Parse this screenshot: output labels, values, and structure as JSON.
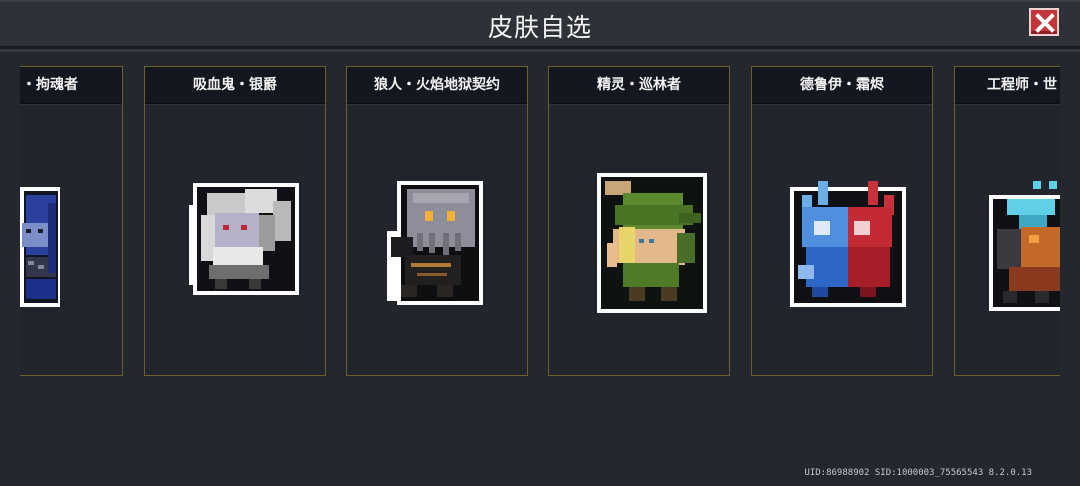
{
  "header": {
    "title": "皮肤自选"
  },
  "close_icon": "close-icon",
  "skins": [
    {
      "name": "・拘魂者"
    },
    {
      "name": "吸血鬼・银爵"
    },
    {
      "name": "狼人・火焰地狱契约"
    },
    {
      "name": "精灵・巡林者"
    },
    {
      "name": "德鲁伊・霜烬"
    },
    {
      "name": "工程师・世"
    }
  ],
  "footer": {
    "build_info": "UID:86988902 SID:1000003_75565543 8.2.0.13"
  },
  "colors": {
    "accent_close": "#c2363a",
    "card_border": "#6f5e2c",
    "background": "#24272e"
  }
}
